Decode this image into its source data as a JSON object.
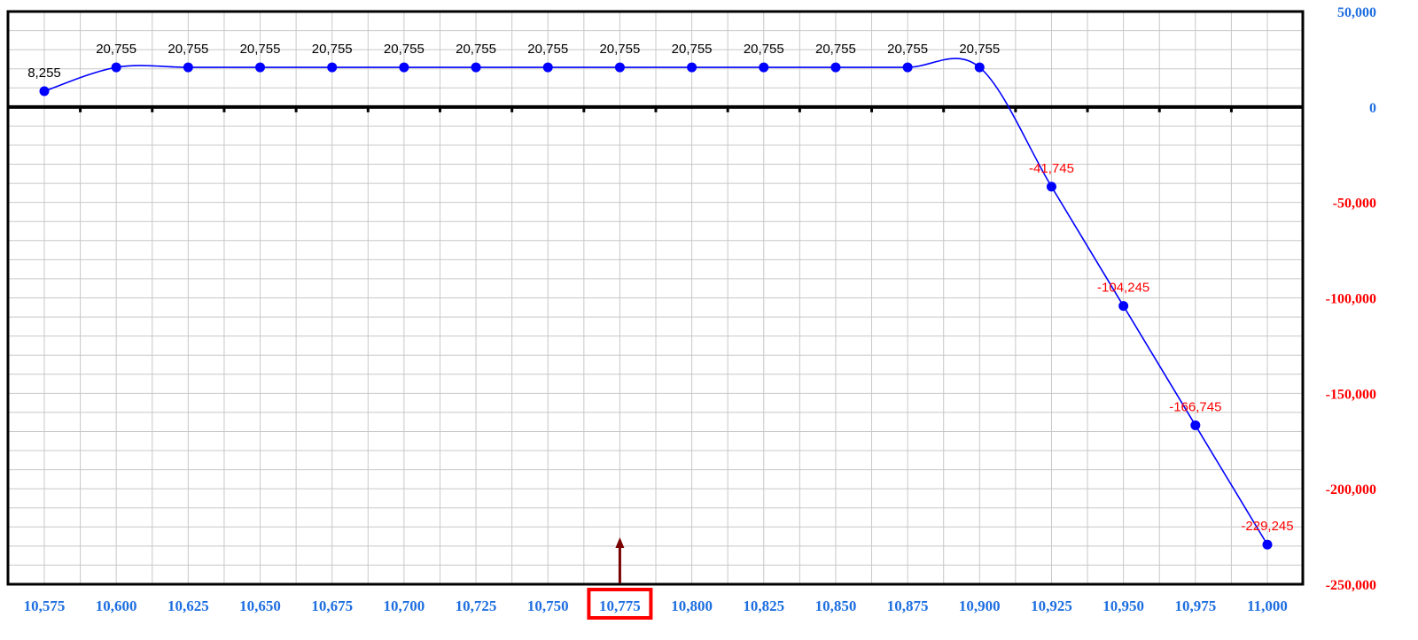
{
  "chart_data": {
    "type": "line",
    "title": "",
    "xlabel": "",
    "ylabel": "",
    "x": [
      10575,
      10600,
      10625,
      10650,
      10675,
      10700,
      10725,
      10750,
      10775,
      10800,
      10825,
      10850,
      10875,
      10900,
      10925,
      10950,
      10975,
      11000
    ],
    "x_tick_labels": [
      "10,575",
      "10,600",
      "10,625",
      "10,650",
      "10,675",
      "10,700",
      "10,725",
      "10,750",
      "10,775",
      "10,800",
      "10,825",
      "10,850",
      "10,875",
      "10,900",
      "10,925",
      "10,950",
      "10,975",
      "11,000"
    ],
    "series": [
      {
        "values": [
          8255,
          20755,
          20755,
          20755,
          20755,
          20755,
          20755,
          20755,
          20755,
          20755,
          20755,
          20755,
          20755,
          20755,
          -41745,
          -104245,
          -166745,
          -229245
        ],
        "labels": [
          "8,255",
          "20,755",
          "20,755",
          "20,755",
          "20,755",
          "20,755",
          "20,755",
          "20,755",
          "20,755",
          "20,755",
          "20,755",
          "20,755",
          "20,755",
          "20,755",
          "-41,745",
          "-104,245",
          "-166,745",
          "-229,245"
        ]
      }
    ],
    "ylim": [
      -250000,
      50000
    ],
    "y_ticks": [
      50000,
      0,
      -50000,
      -100000,
      -150000,
      -200000,
      -250000
    ],
    "y_tick_labels": [
      "50,000",
      "0",
      "-50,000",
      "-100,000",
      "-150,000",
      "-200,000",
      "-250,000"
    ],
    "grid": true,
    "marker_x": 10775,
    "highlighted_x_label": "10,775",
    "colors": {
      "line": "#0000ff",
      "points": "#0000ff",
      "positive_label": "#000000",
      "negative_label": "#ff0000",
      "x_tick": "#1f6fe0",
      "y_tick_positive": "#1f6fe0",
      "y_tick_negative": "#ff0000",
      "grid": "#c8c8c8",
      "axis": "#000000",
      "highlight_box": "#ff0000",
      "marker_arrow": "#7a0000"
    }
  }
}
